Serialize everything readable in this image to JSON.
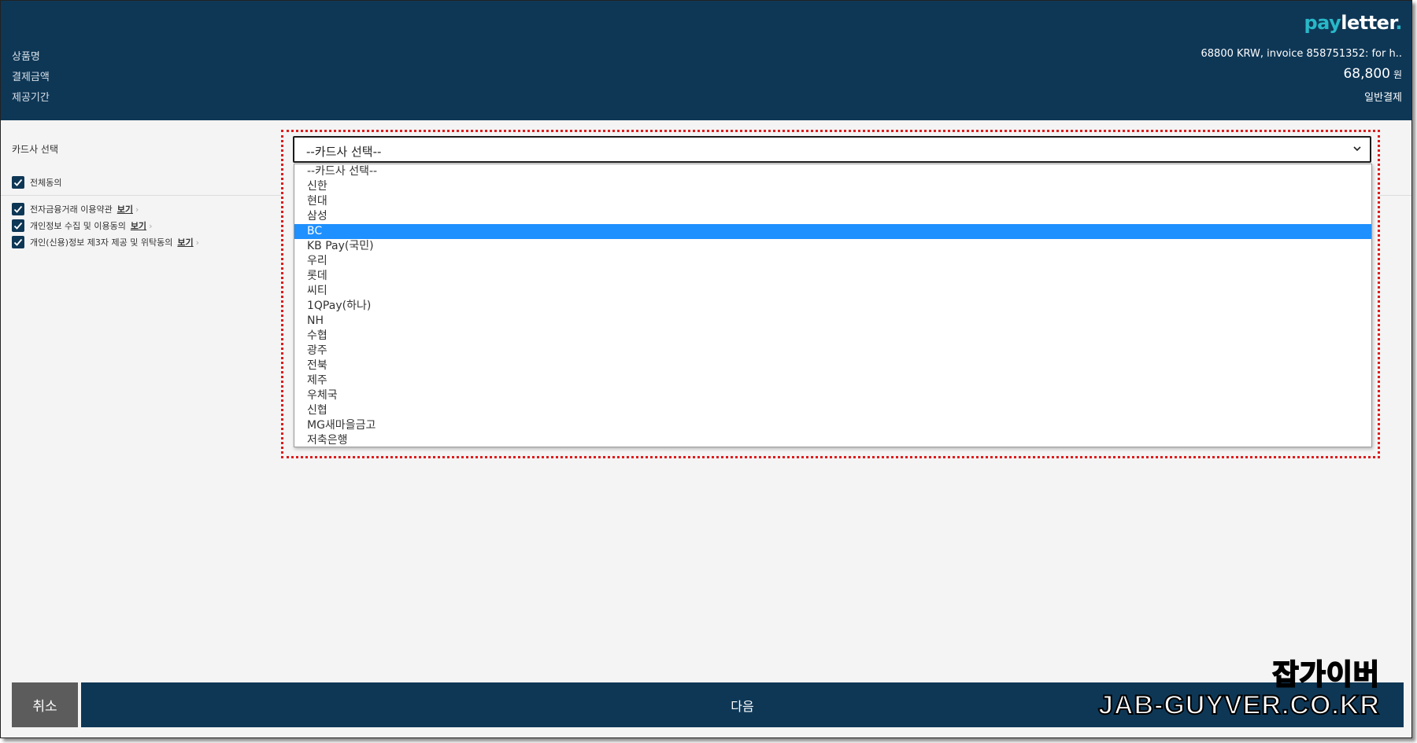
{
  "header": {
    "logo_pay": "pay",
    "logo_letter": "letter",
    "logo_dot": ".",
    "product_label": "상품명",
    "amount_label": "결제금액",
    "period_label": "제공기간",
    "product_value": "68800 KRW, invoice 858751352: for h..",
    "amount_value": "68,800",
    "amount_unit": "원",
    "period_value": "일반결제"
  },
  "card_select": {
    "label": "카드사 선택",
    "current_value": "--카드사 선택--",
    "options": [
      "--카드사 선택--",
      "신한",
      "현대",
      "삼성",
      "BC",
      "KB Pay(국민)",
      "우리",
      "롯데",
      "씨티",
      "1QPay(하나)",
      "NH",
      "수협",
      "광주",
      "전북",
      "제주",
      "우체국",
      "신협",
      "MG새마을금고",
      "저축은행"
    ],
    "highlighted_option": "BC"
  },
  "agreements": {
    "all_label": "전체동의",
    "items": [
      {
        "label": "전자금융거래 이용약관",
        "link": "보기"
      },
      {
        "label": "개인정보 수집 및 이용동의",
        "link": "보기"
      },
      {
        "label": "개인(신용)정보 제3자 제공 및 위탁동의",
        "link": "보기"
      }
    ]
  },
  "footer": {
    "cancel_label": "취소",
    "next_label": "다음"
  },
  "watermark": {
    "korean": "잡가이버",
    "english": "JAB-GUYVER.CO.KR"
  },
  "colors": {
    "header_bg": "#0e3756",
    "highlight": "#1e90ff",
    "annotation_red": "#e01a1a",
    "cancel_bg": "#5c5c5c"
  },
  "icons": {
    "chevron": "chevron-down-icon",
    "checkbox": "check-icon"
  }
}
